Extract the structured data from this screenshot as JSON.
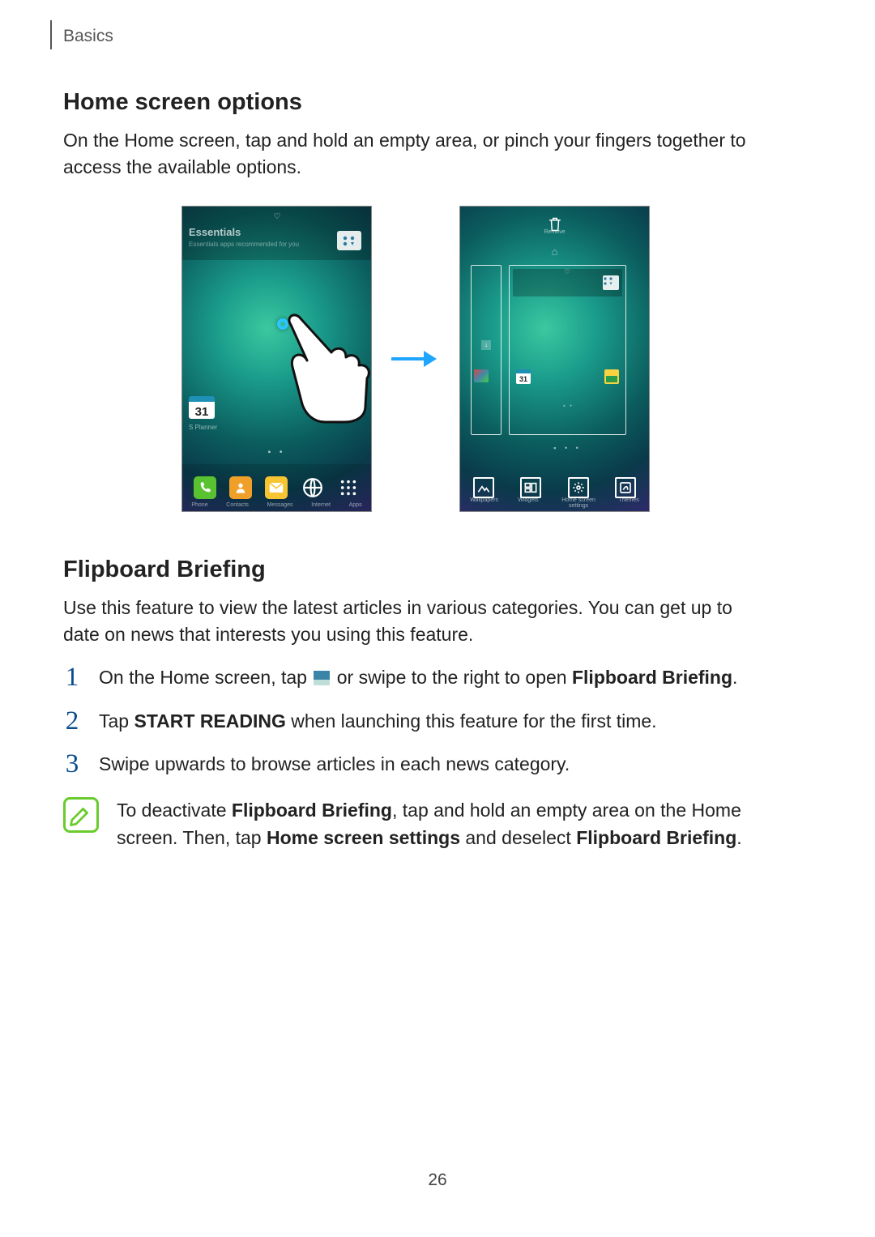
{
  "header": {
    "section": "Basics"
  },
  "section1": {
    "title": "Home screen options",
    "body": "On the Home screen, tap and hold an empty area, or pinch your fingers together to access the available options."
  },
  "screen1": {
    "panel_title": "Essentials",
    "panel_sub": "Essentials apps recommended for you",
    "calendar_day": "31",
    "calendar_label": "S Planner",
    "dock": [
      "Phone",
      "Contacts",
      "Messages",
      "Internet",
      "Apps"
    ]
  },
  "screen2": {
    "remove_label": "Remove",
    "calendar_day": "31",
    "bottom": [
      "Wallpapers",
      "Widgets",
      "Home screen settings",
      "Themes"
    ]
  },
  "section2": {
    "title": "Flipboard Briefing",
    "body": "Use this feature to view the latest articles in various categories. You can get up to date on news that interests you using this feature.",
    "steps": {
      "1a": "On the Home screen, tap ",
      "1b": " or swipe to the right to open ",
      "1c": "Flipboard Briefing",
      "1d": ".",
      "2a": "Tap ",
      "2b": "START READING",
      "2c": " when launching this feature for the first time.",
      "3": "Swipe upwards to browse articles in each news category."
    },
    "note": {
      "a": "To deactivate ",
      "b": "Flipboard Briefing",
      "c": ", tap and hold an empty area on the Home screen. Then, tap ",
      "d": "Home screen settings",
      "e": " and deselect ",
      "f": "Flipboard Briefing",
      "g": "."
    }
  },
  "page_number": "26"
}
